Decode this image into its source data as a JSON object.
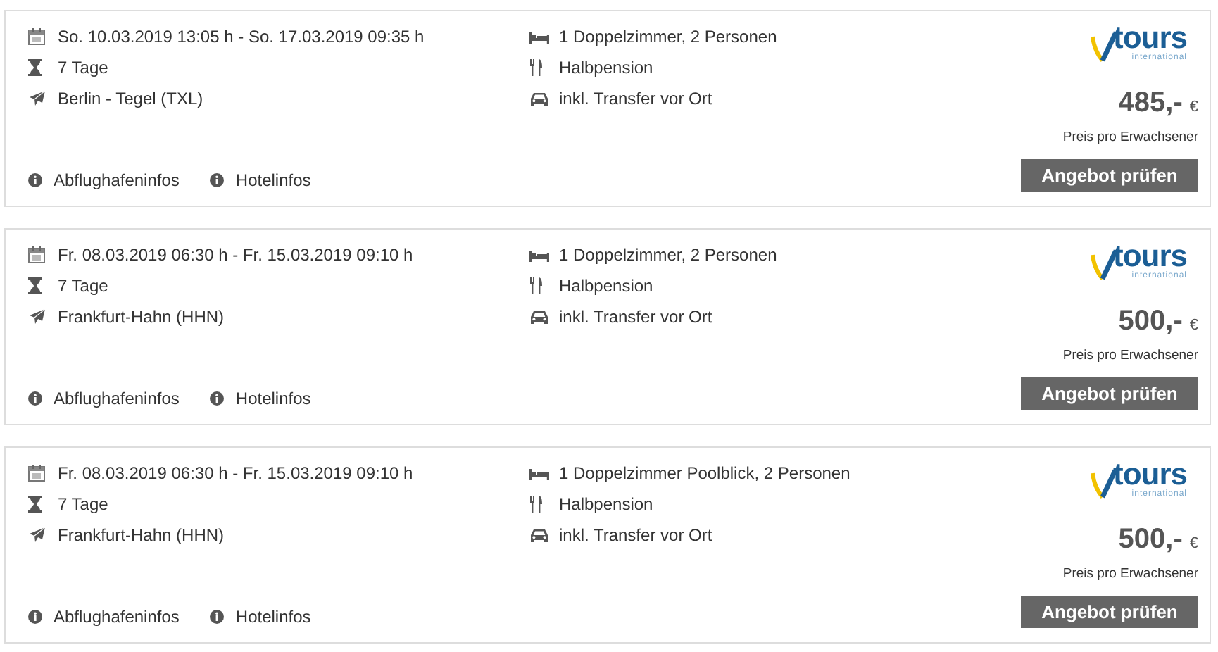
{
  "offers": [
    {
      "dates": "So. 10.03.2019 13:05 h - So. 17.03.2019 09:35 h",
      "duration": "7 Tage",
      "airport": "Berlin - Tegel (TXL)",
      "room": "1 Doppelzimmer, 2 Personen",
      "board": "Halbpension",
      "transfer": "inkl. Transfer vor Ort",
      "links": [
        "Abflughafeninfos",
        "Hotelinfos"
      ],
      "logo": {
        "name": "tours",
        "tagline": "international"
      },
      "price": "485,-",
      "currency": "€",
      "price_note": "Preis pro Erwachsener",
      "button": "Angebot prüfen"
    },
    {
      "dates": "Fr. 08.03.2019 06:30 h - Fr. 15.03.2019 09:10 h",
      "duration": "7 Tage",
      "airport": "Frankfurt-Hahn (HHN)",
      "room": "1 Doppelzimmer, 2 Personen",
      "board": "Halbpension",
      "transfer": "inkl. Transfer vor Ort",
      "links": [
        "Abflughafeninfos",
        "Hotelinfos"
      ],
      "logo": {
        "name": "tours",
        "tagline": "international"
      },
      "price": "500,-",
      "currency": "€",
      "price_note": "Preis pro Erwachsener",
      "button": "Angebot prüfen"
    },
    {
      "dates": "Fr. 08.03.2019 06:30 h - Fr. 15.03.2019 09:10 h",
      "duration": "7 Tage",
      "airport": "Frankfurt-Hahn (HHN)",
      "room": "1 Doppelzimmer Poolblick, 2 Personen",
      "board": "Halbpension",
      "transfer": "inkl. Transfer vor Ort",
      "links": [
        "Abflughafeninfos",
        "Hotelinfos"
      ],
      "logo": {
        "name": "tours",
        "tagline": "international"
      },
      "price": "500,-",
      "currency": "€",
      "price_note": "Preis pro Erwachsener",
      "button": "Angebot prüfen"
    }
  ]
}
